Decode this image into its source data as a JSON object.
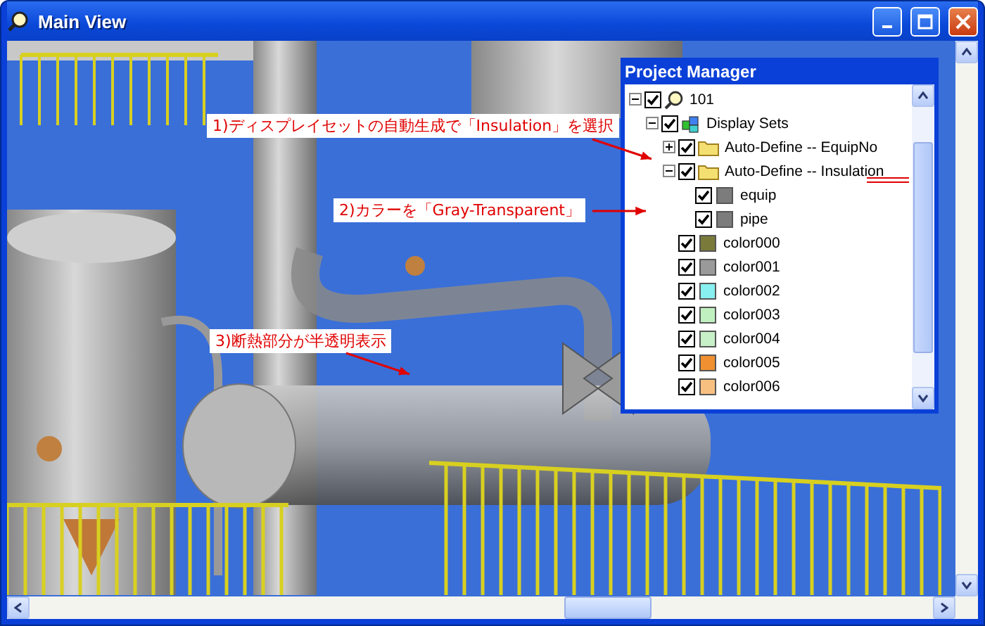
{
  "window": {
    "title": "Main View"
  },
  "annotations": [
    {
      "text": "1)ディスプレイセットの自動生成で「Insulation」を選択"
    },
    {
      "text": "2)カラーを「Gray-Transparent」"
    },
    {
      "text": "3)断熱部分が半透明表示"
    }
  ],
  "project_manager": {
    "title": "Project Manager",
    "tree": [
      {
        "label": "101",
        "kind": "root",
        "checked": true,
        "expanded": true,
        "underlined": false,
        "children": [
          {
            "label": "Display Sets",
            "kind": "group",
            "checked": true,
            "expanded": true,
            "underlined": false,
            "children": [
              {
                "label": "Auto-Define -- EquipNo",
                "kind": "folder",
                "checked": true,
                "expanded": false,
                "underlined": false
              },
              {
                "label": "Auto-Define -- Insulation",
                "kind": "folder",
                "checked": true,
                "expanded": true,
                "underlined": true,
                "children": [
                  {
                    "label": "equip",
                    "kind": "swatch",
                    "checked": true,
                    "color": "#7c7c7c",
                    "underlined": false
                  },
                  {
                    "label": "pipe",
                    "kind": "swatch",
                    "checked": true,
                    "color": "#7c7c7c",
                    "underlined": false
                  }
                ]
              },
              {
                "label": "color000",
                "kind": "swatch",
                "checked": true,
                "color": "#7a7a3a",
                "underlined": false
              },
              {
                "label": "color001",
                "kind": "swatch",
                "checked": true,
                "color": "#9a9a9a",
                "underlined": false
              },
              {
                "label": "color002",
                "kind": "swatch",
                "checked": true,
                "color": "#88f0f0",
                "underlined": false
              },
              {
                "label": "color003",
                "kind": "swatch",
                "checked": true,
                "color": "#c0f0c0",
                "underlined": false
              },
              {
                "label": "color004",
                "kind": "swatch",
                "checked": true,
                "color": "#c8f0c8",
                "underlined": false
              },
              {
                "label": "color005",
                "kind": "swatch",
                "checked": true,
                "color": "#f09030",
                "underlined": false
              },
              {
                "label": "color006",
                "kind": "swatch",
                "checked": true,
                "color": "#f8c080",
                "underlined": false
              }
            ]
          }
        ]
      }
    ]
  }
}
